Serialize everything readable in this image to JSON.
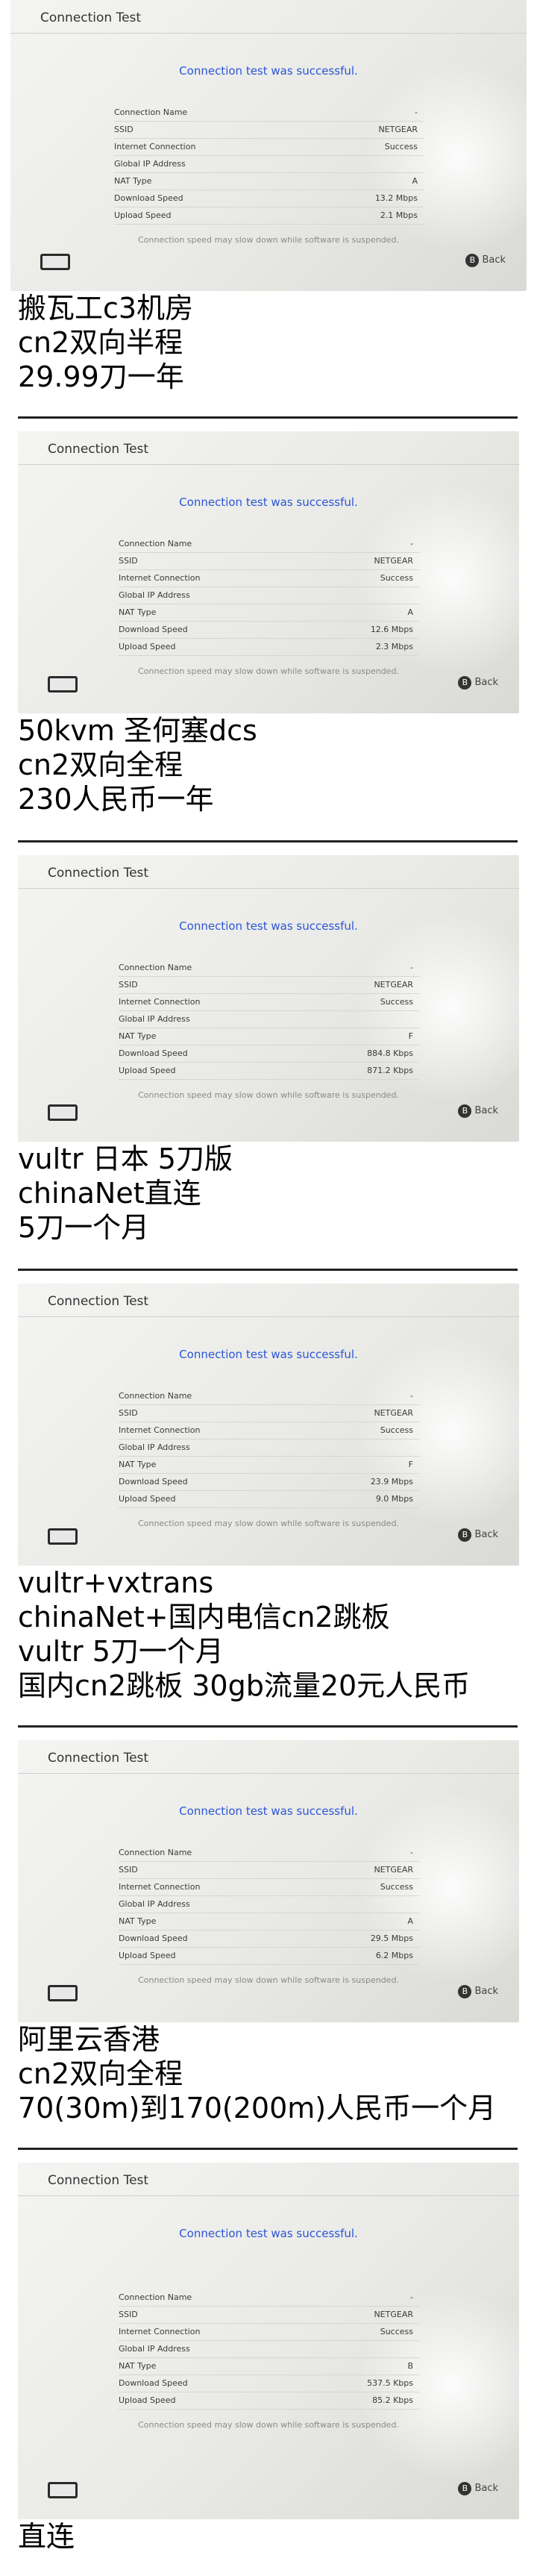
{
  "screen": {
    "title": "Connection Test",
    "success_message": "Connection test was successful.",
    "note": "Connection speed may slow down while software is suspended.",
    "back_label": "Back",
    "back_button": "B",
    "labels": {
      "connection_name": "Connection Name",
      "ssid": "SSID",
      "internet_connection": "Internet Connection",
      "global_ip": "Global IP Address",
      "nat_type": "NAT Type",
      "download_speed": "Download Speed",
      "upload_speed": "Upload Speed"
    }
  },
  "tests": [
    {
      "connection_name": "-",
      "ssid": "NETGEAR",
      "internet_connection": "Success",
      "global_ip": "",
      "nat_type": "A",
      "download_speed": "13.2 Mbps",
      "upload_speed": "2.1 Mbps",
      "caption": [
        "搬瓦工c3机房",
        "cn2双向半程",
        "29.99刀一年"
      ]
    },
    {
      "connection_name": "-",
      "ssid": "NETGEAR",
      "internet_connection": "Success",
      "global_ip": "",
      "nat_type": "A",
      "download_speed": "12.6 Mbps",
      "upload_speed": "2.3 Mbps",
      "caption": [
        "50kvm 圣何塞dcs",
        "cn2双向全程",
        "230人民币一年"
      ]
    },
    {
      "connection_name": "-",
      "ssid": "NETGEAR",
      "internet_connection": "Success",
      "global_ip": "",
      "nat_type": "F",
      "download_speed": "884.8 Kbps",
      "upload_speed": "871.2 Kbps",
      "caption": [
        "vultr 日本 5刀版",
        "chinaNet直连",
        "5刀一个月"
      ]
    },
    {
      "connection_name": "-",
      "ssid": "NETGEAR",
      "internet_connection": "Success",
      "global_ip": "",
      "nat_type": "F",
      "download_speed": "23.9 Mbps",
      "upload_speed": "9.0 Mbps",
      "caption": [
        "vultr+vxtrans",
        "chinaNet+国内电信cn2跳板",
        "vultr 5刀一个月",
        "国内cn2跳板 30gb流量20元人民币"
      ]
    },
    {
      "connection_name": "-",
      "ssid": "NETGEAR",
      "internet_connection": "Success",
      "global_ip": "",
      "nat_type": "A",
      "download_speed": "29.5 Mbps",
      "upload_speed": "6.2 Mbps",
      "caption": [
        "阿里云香港",
        "cn2双向全程",
        "70(30m)到170(200m)人民币一个月"
      ]
    },
    {
      "connection_name": "-",
      "ssid": "NETGEAR",
      "internet_connection": "Success",
      "global_ip": "",
      "nat_type": "B",
      "download_speed": "537.5 Kbps",
      "upload_speed": "85.2 Kbps",
      "caption": [
        "直连"
      ]
    }
  ]
}
